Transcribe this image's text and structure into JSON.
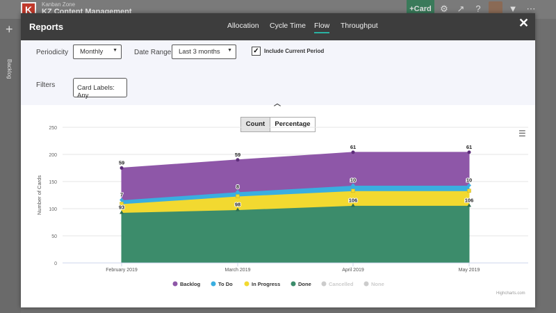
{
  "app": {
    "subtitle": "Kanban Zone",
    "title": "KZ Content Management",
    "card_button": "+Card",
    "side_label": "Backlog"
  },
  "modal": {
    "title": "Reports",
    "tabs": [
      "Allocation",
      "Cycle Time",
      "Flow",
      "Throughput"
    ],
    "active_tab": "Flow",
    "close": "✕"
  },
  "filters": {
    "periodicity_label": "Periodicity",
    "periodicity_value": "Monthly",
    "date_range_label": "Date Range",
    "date_range_value": "Last 3 months",
    "include_current_label": "Include Current Period",
    "include_current_checked": true,
    "filters_label": "Filters",
    "card_labels_value": "Card Labels: Any"
  },
  "view_toggle": {
    "count_label": "Count",
    "percentage_label": "Percentage",
    "selected": "Count"
  },
  "credit": "Highcharts.com",
  "chart_data": {
    "type": "area",
    "stacked": true,
    "categories": [
      "February 2019",
      "March 2019",
      "April 2019",
      "May 2019"
    ],
    "ylabel": "Number of Cards",
    "ylim": [
      0,
      250
    ],
    "yticks": [
      0,
      50,
      100,
      150,
      200,
      250
    ],
    "grid": true,
    "legend_position": "bottom",
    "series": [
      {
        "name": "Backlog",
        "color": "#8e57a8",
        "values": [
          59,
          59,
          61,
          61
        ]
      },
      {
        "name": "To Do",
        "color": "#3aaee0",
        "values": [
          7,
          8,
          10,
          10
        ]
      },
      {
        "name": "In Progress",
        "color": "#f2d930",
        "values": [
          16,
          25,
          27,
          27
        ]
      },
      {
        "name": "Done",
        "color": "#3c8c6b",
        "values": [
          93,
          98,
          106,
          106
        ]
      },
      {
        "name": "Cancelled",
        "color": "#cccccc",
        "values": [
          0,
          0,
          0,
          0
        ],
        "hidden": true
      },
      {
        "name": "None",
        "color": "#cccccc",
        "values": [
          0,
          0,
          0,
          0
        ],
        "hidden": true
      }
    ],
    "data_labels": {
      "Backlog": [
        "59",
        "59",
        "61",
        "61"
      ],
      "To Do": [
        "7",
        "8",
        "10",
        "10"
      ],
      "Done": [
        "93",
        "98",
        "106",
        "106"
      ]
    }
  }
}
